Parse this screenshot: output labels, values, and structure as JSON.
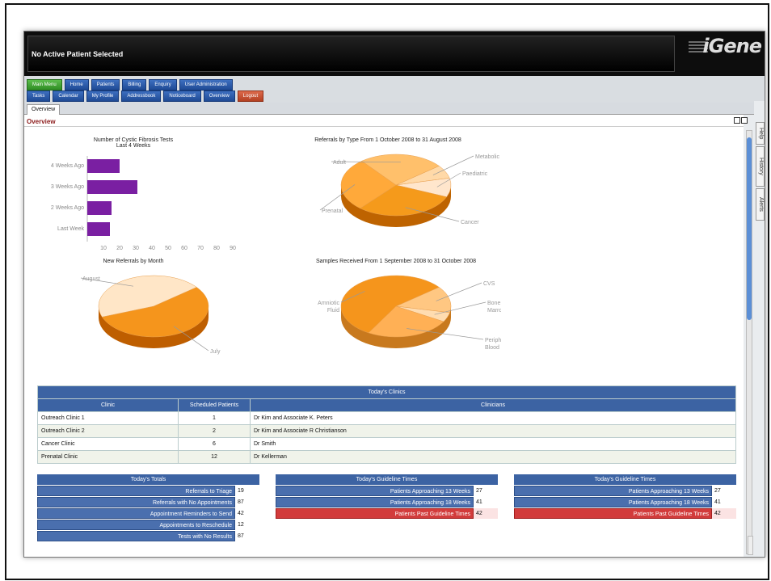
{
  "header": {
    "patient_status": "No Active Patient Selected",
    "logo": "iGene"
  },
  "nav": {
    "row1": [
      "Main Menu",
      "Home",
      "Patients",
      "Billing",
      "Enquiry",
      "User Administration"
    ],
    "row2": [
      "Tasks",
      "Calendar",
      "My Profile",
      "Addressbook",
      "Noticeboard",
      "Overview",
      "Logout"
    ]
  },
  "tabs": {
    "active": "Overview"
  },
  "section_title": "Overview",
  "side_tabs": [
    "Help",
    "History",
    "Alerts"
  ],
  "charts": {
    "cf_tests": {
      "title_line1": "Number of Cystic Fibrosis Tests",
      "title_line2": "Last 4 Weeks"
    },
    "referrals_type": {
      "title": "Referrals by Type From 1 October 2008 to 31 August 2008"
    },
    "new_referrals": {
      "title": "New Referrals by Month"
    },
    "samples": {
      "title": "Samples Received From 1 September 2008 to 31 October 2008"
    }
  },
  "chart_data": [
    {
      "type": "bar",
      "orientation": "horizontal",
      "title": "Number of Cystic Fibrosis Tests",
      "subtitle": "Last 4 Weeks",
      "categories": [
        "4 Weeks Ago",
        "3 Weeks Ago",
        "2 Weeks Ago",
        "Last Week"
      ],
      "values": [
        20,
        31,
        15,
        14
      ],
      "xlim": [
        0,
        90
      ],
      "xticks": [
        10,
        20,
        30,
        40,
        50,
        60,
        70,
        80,
        90
      ],
      "color": "#7a1fa2"
    },
    {
      "type": "pie",
      "title": "Referrals by Type From 1 October 2008 to 31 August 2008",
      "labels": [
        "Metabolic",
        "Paediatric",
        "Cancer",
        "Prenatal",
        "Adult"
      ],
      "values": [
        7,
        10,
        30,
        28,
        25
      ]
    },
    {
      "type": "pie",
      "title": "New Referrals by Month",
      "labels": [
        "July",
        "August"
      ],
      "values": [
        55,
        45
      ]
    },
    {
      "type": "pie",
      "title": "Samples Received From 1 September 2008 to 31 October 2008",
      "labels": [
        "CVS",
        "Bone Marrow",
        "Peripheral Blood",
        "Amniotic Fluid"
      ],
      "values": [
        14,
        5,
        25,
        56
      ]
    }
  ],
  "clinics": {
    "title": "Today's Clinics",
    "columns": [
      "Clinic",
      "Scheduled Patients",
      "Clinicians"
    ],
    "rows": [
      [
        "Outreach Clinic 1",
        "1",
        "Dr Kim and Associate K. Peters"
      ],
      [
        "Outreach Clinic 2",
        "2",
        "Dr Kim and Associate R Christianson"
      ],
      [
        "Cancer Clinic",
        "6",
        "Dr Smith"
      ],
      [
        "Prenatal Clinic",
        "12",
        "Dr Kellerman"
      ]
    ]
  },
  "totals": {
    "title": "Today's Totals",
    "rows": [
      {
        "label": "Referrals to Triage",
        "value": "19"
      },
      {
        "label": "Referrals with No Appointments",
        "value": "87"
      },
      {
        "label": "Appointment Reminders to Send",
        "value": "42"
      },
      {
        "label": "Appointments to Reschedule",
        "value": "12"
      },
      {
        "label": "Tests with No Results",
        "value": "87"
      }
    ]
  },
  "guideline1": {
    "title": "Today's Guideline Times",
    "rows": [
      {
        "label": "Patients Approaching 13 Weeks",
        "value": "27"
      },
      {
        "label": "Patients Approaching 18 Weeks",
        "value": "41"
      },
      {
        "label": "Patients Past Guideline Times",
        "value": "42"
      }
    ]
  },
  "guideline2": {
    "title": "Today's Guideline Times",
    "rows": [
      {
        "label": "Patients Approaching 13 Weeks",
        "value": "27"
      },
      {
        "label": "Patients Approaching 18 Weeks",
        "value": "41"
      },
      {
        "label": "Patients Past Guideline Times",
        "value": "42"
      }
    ]
  }
}
